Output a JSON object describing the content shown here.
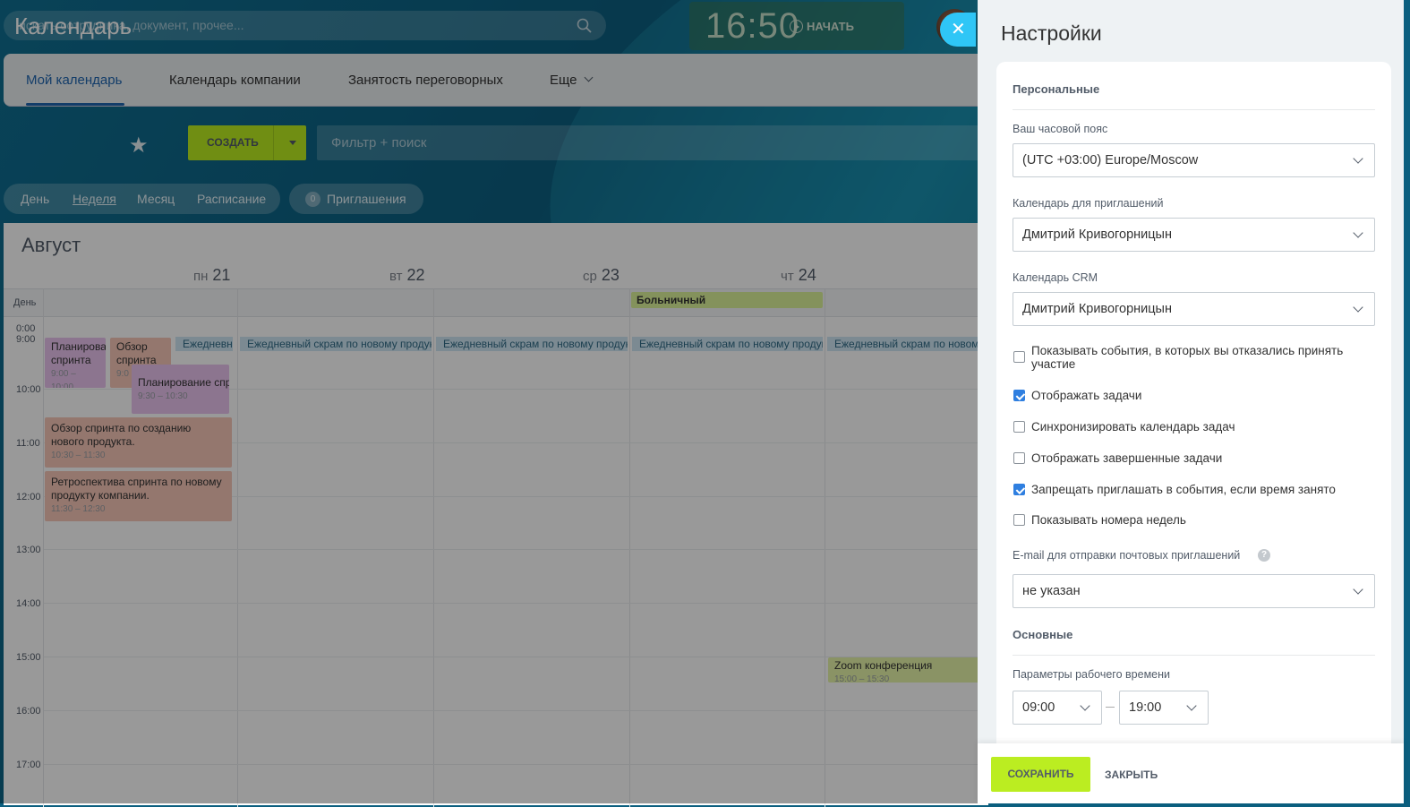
{
  "header": {
    "search_placeholder": "искать сотрудника, документ, прочее...",
    "timer": "16:50",
    "timer_start": "НАЧАТЬ"
  },
  "nav": {
    "tabs": [
      {
        "label": "Мой календарь"
      },
      {
        "label": "Календарь компании"
      },
      {
        "label": "Занятость переговорных"
      },
      {
        "label": "Еще"
      }
    ]
  },
  "calendar": {
    "title": "Календарь",
    "create_label": "СОЗДАТЬ",
    "filter_placeholder": "Фильтр + поиск",
    "views": [
      {
        "label": "День"
      },
      {
        "label": "Неделя"
      },
      {
        "label": "Месяц"
      },
      {
        "label": "Расписание"
      }
    ],
    "invitations_count": "0",
    "invitations_label": "Приглашения",
    "month": "Август",
    "days": [
      {
        "dow": "пн",
        "num": "21"
      },
      {
        "dow": "вт",
        "num": "22"
      },
      {
        "dow": "ср",
        "num": "23"
      },
      {
        "dow": "чт",
        "num": "24"
      }
    ],
    "allday_label": "День",
    "hours": [
      "0:00",
      "9:00",
      "10:00",
      "11:00",
      "12:00",
      "13:00",
      "14:00",
      "15:00",
      "16:00",
      "17:00"
    ],
    "events": {
      "sick": "Больничный",
      "daily": "Ежедневный скрам по новому продукту",
      "daily_short": "Ежедневн",
      "plan1": "Планирование спринта",
      "plan1_time": "9:00 – 10:00",
      "review1": "Обзор спринта",
      "review1_time": "9:0",
      "plan2": "Планирование спр",
      "plan2_time": "9:30 – 10:30",
      "review2": "Обзор спринта по созданию нового продукта.",
      "review2_time": "10:30 – 11:30",
      "retro": "Ретроспектива спринта по новому продукту компании.",
      "retro_time": "11:30 – 12:30",
      "zoom": "Zoom конференция",
      "zoom_time": "15:00 – 15:30"
    }
  },
  "settings": {
    "title": "Настройки",
    "personal": "Персональные",
    "tz_label": "Ваш часовой пояс",
    "tz_value": "(UTC +03:00) Europe/Moscow",
    "inv_cal_label": "Календарь для приглашений",
    "inv_cal_value": "Дмитрий Кривогорницын",
    "crm_label": "Календарь CRM",
    "crm_value": "Дмитрий Кривогорницын",
    "checkboxes": [
      {
        "label": "Показывать события, в которых вы отказались принять участие",
        "checked": false
      },
      {
        "label": "Отображать задачи",
        "checked": true
      },
      {
        "label": "Синхронизировать календарь задач",
        "checked": false
      },
      {
        "label": "Отображать завершенные задачи",
        "checked": false
      },
      {
        "label": "Запрещать приглашать в события, если время занято",
        "checked": true
      },
      {
        "label": "Показывать номера недель",
        "checked": false
      }
    ],
    "email_label": "E-mail для отправки почтовых приглашений",
    "email_value": "не указан",
    "basic": "Основные",
    "work_label": "Параметры рабочего времени",
    "work_from": "09:00",
    "work_to": "19:00",
    "save": "СОХРАНИТЬ",
    "close": "ЗАКРЫТЬ"
  }
}
